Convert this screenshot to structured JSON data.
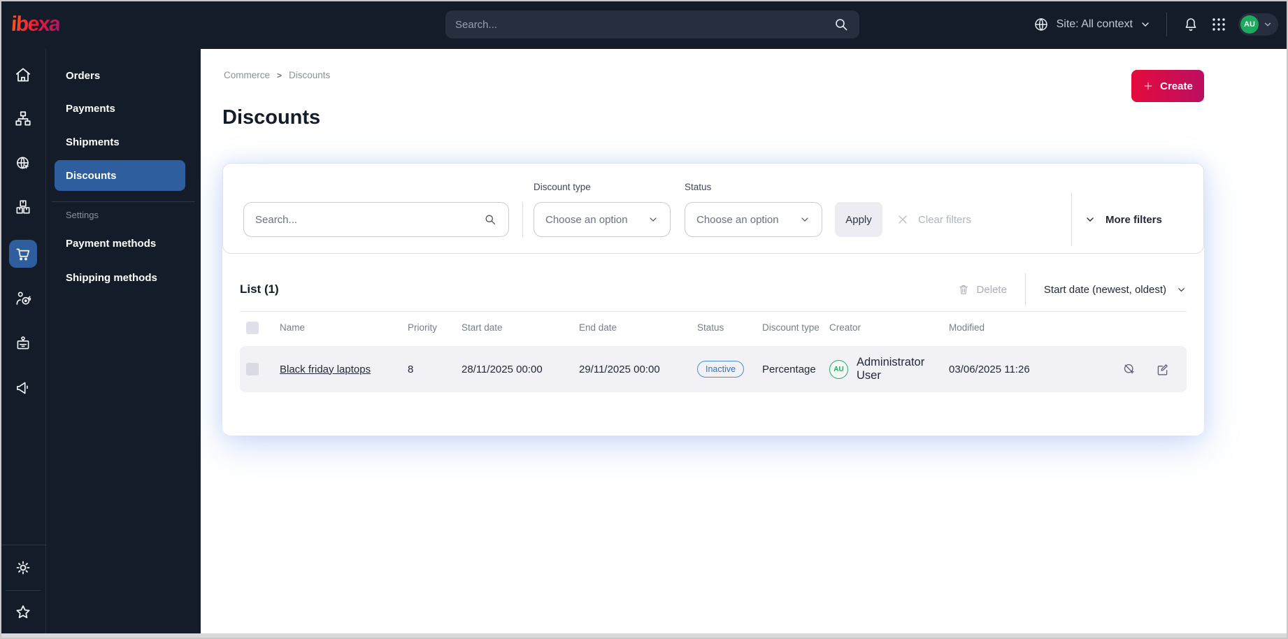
{
  "topbar": {
    "logo": "ibexa",
    "search_placeholder": "Search...",
    "site_selector": "Site: All context",
    "avatar_initials": "AU"
  },
  "menu": {
    "items": [
      "Orders",
      "Payments",
      "Shipments",
      "Discounts"
    ],
    "active_item": "Discounts",
    "section_label": "Settings",
    "settings_items": [
      "Payment methods",
      "Shipping methods"
    ]
  },
  "breadcrumb": {
    "parent": "Commerce",
    "separator": ">",
    "current": "Discounts"
  },
  "page": {
    "title": "Discounts",
    "create_label": "Create"
  },
  "filters": {
    "search_placeholder": "Search...",
    "discount_type_label": "Discount type",
    "discount_type_value": "Choose an option",
    "status_label": "Status",
    "status_value": "Choose an option",
    "apply_label": "Apply",
    "clear_label": "Clear filters",
    "more_label": "More filters"
  },
  "list": {
    "title": "List (1)",
    "delete_label": "Delete",
    "sort_label": "Start date (newest, oldest)",
    "columns": [
      "Name",
      "Priority",
      "Start date",
      "End date",
      "Status",
      "Discount type",
      "Creator",
      "Modified"
    ],
    "rows": [
      {
        "name": "Black friday laptops",
        "priority": "8",
        "start_date": "28/11/2025 00:00",
        "end_date": "29/11/2025 00:00",
        "status": "Inactive",
        "discount_type": "Percentage",
        "creator_initials": "AU",
        "creator": "Administrator User",
        "modified": "03/06/2025 11:26"
      }
    ]
  },
  "colors": {
    "topbar_bg": "#141c2a",
    "active_blue": "#2f5e9e",
    "create_gradient": [
      "#e40a3c",
      "#bc0f62"
    ],
    "badge_blue": "#4a8ed6",
    "avatar_green": "#27a45e"
  }
}
